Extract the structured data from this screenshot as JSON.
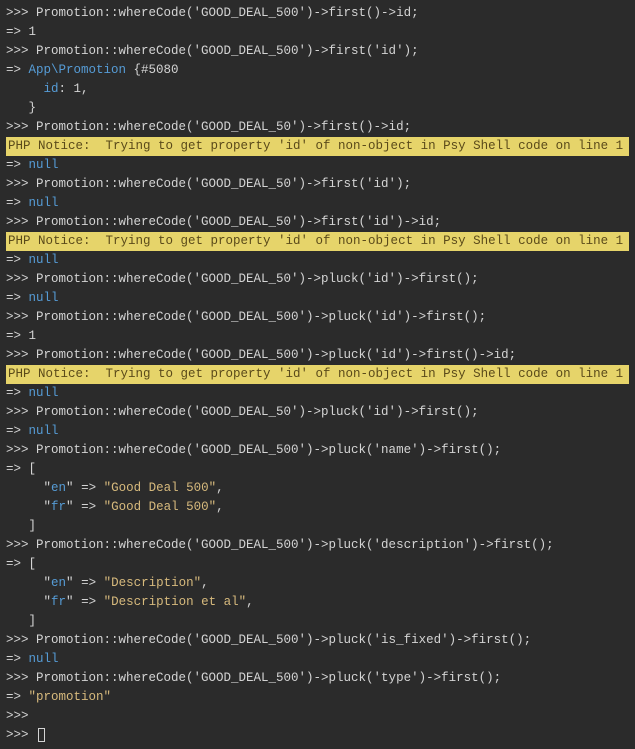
{
  "lines": [
    {
      "type": "cmd",
      "text": ">>> Promotion::whereCode('GOOD_DEAL_500')->first()->id;"
    },
    {
      "type": "result",
      "text": "=> 1"
    },
    {
      "type": "cmd",
      "text": ">>> Promotion::whereCode('GOOD_DEAL_500')->first('id');"
    },
    {
      "type": "obj-open",
      "prefix": "=> ",
      "ns": "App\\Promotion",
      "hash": " {#5080"
    },
    {
      "type": "obj-prop",
      "prop": "id",
      "val": ": 1,"
    },
    {
      "type": "obj-close",
      "text": "   }"
    },
    {
      "type": "cmd",
      "text": ">>> Promotion::whereCode('GOOD_DEAL_50')->first()->id;"
    },
    {
      "type": "notice",
      "text": "PHP Notice:  Trying to get property 'id' of non-object in Psy Shell code on line 1"
    },
    {
      "type": "result-null",
      "prefix": "=> ",
      "val": "null"
    },
    {
      "type": "cmd",
      "text": ">>> Promotion::whereCode('GOOD_DEAL_50')->first('id');"
    },
    {
      "type": "result-null",
      "prefix": "=> ",
      "val": "null"
    },
    {
      "type": "cmd",
      "text": ">>> Promotion::whereCode('GOOD_DEAL_50')->first('id')->id;"
    },
    {
      "type": "notice",
      "text": "PHP Notice:  Trying to get property 'id' of non-object in Psy Shell code on line 1"
    },
    {
      "type": "result-null",
      "prefix": "=> ",
      "val": "null"
    },
    {
      "type": "cmd",
      "text": ">>> Promotion::whereCode('GOOD_DEAL_50')->pluck('id')->first();"
    },
    {
      "type": "result-null",
      "prefix": "=> ",
      "val": "null"
    },
    {
      "type": "cmd",
      "text": ">>> Promotion::whereCode('GOOD_DEAL_500')->pluck('id')->first();"
    },
    {
      "type": "result",
      "text": "=> 1"
    },
    {
      "type": "cmd",
      "text": ">>> Promotion::whereCode('GOOD_DEAL_500')->pluck('id')->first()->id;"
    },
    {
      "type": "notice",
      "text": "PHP Notice:  Trying to get property 'id' of non-object in Psy Shell code on line 1"
    },
    {
      "type": "result-null",
      "prefix": "=> ",
      "val": "null"
    },
    {
      "type": "cmd",
      "text": ">>> Promotion::whereCode('GOOD_DEAL_50')->pluck('id')->first();"
    },
    {
      "type": "result-null",
      "prefix": "=> ",
      "val": "null"
    },
    {
      "type": "cmd",
      "text": ">>> Promotion::whereCode('GOOD_DEAL_500')->pluck('name')->first();"
    },
    {
      "type": "arr-open",
      "text": "=> ["
    },
    {
      "type": "arr-kv",
      "k": "en",
      "v": "Good Deal 500"
    },
    {
      "type": "arr-kv",
      "k": "fr",
      "v": "Good Deal 500"
    },
    {
      "type": "arr-close",
      "text": "   ]"
    },
    {
      "type": "cmd",
      "text": ">>> Promotion::whereCode('GOOD_DEAL_500')->pluck('description')->first();"
    },
    {
      "type": "arr-open",
      "text": "=> ["
    },
    {
      "type": "arr-kv",
      "k": "en",
      "v": "Description"
    },
    {
      "type": "arr-kv",
      "k": "fr",
      "v": "Description et al"
    },
    {
      "type": "arr-close",
      "text": "   ]"
    },
    {
      "type": "cmd",
      "text": ">>> Promotion::whereCode('GOOD_DEAL_500')->pluck('is_fixed')->first();"
    },
    {
      "type": "result-null",
      "prefix": "=> ",
      "val": "null"
    },
    {
      "type": "cmd",
      "text": ">>> Promotion::whereCode('GOOD_DEAL_500')->pluck('type')->first();"
    },
    {
      "type": "result-str",
      "prefix": "=> ",
      "val": "\"promotion\""
    },
    {
      "type": "cmd",
      "text": ">>>"
    },
    {
      "type": "cursor",
      "text": ">>> "
    }
  ]
}
